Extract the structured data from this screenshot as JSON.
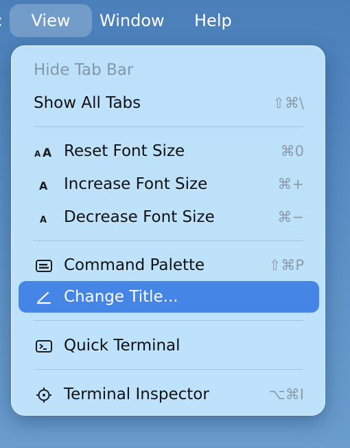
{
  "menubar": {
    "edge_label": ":",
    "items": [
      {
        "label": "View"
      },
      {
        "label": "Window"
      },
      {
        "label": "Help"
      }
    ]
  },
  "menu": {
    "items": [
      {
        "label": "Hide Tab Bar",
        "shortcut": "",
        "disabled": true,
        "icon": ""
      },
      {
        "label": "Show All Tabs",
        "shortcut": "⇧⌘\\",
        "disabled": false,
        "icon": ""
      },
      {
        "label": "Reset Font Size",
        "shortcut": "⌘0",
        "icon": "reset-font-size-icon",
        "icon_text": "AA"
      },
      {
        "label": "Increase Font Size",
        "shortcut": "⌘+",
        "icon": "increase-font-size-icon",
        "icon_text": "A"
      },
      {
        "label": "Decrease Font Size",
        "shortcut": "⌘−",
        "icon": "decrease-font-size-icon",
        "icon_text": "A"
      },
      {
        "label": "Command Palette",
        "shortcut": "⇧⌘P",
        "icon": "command-palette-icon"
      },
      {
        "label": "Change Title...",
        "shortcut": "",
        "icon": "pencil-icon",
        "highlighted": true
      },
      {
        "label": "Quick Terminal",
        "shortcut": "",
        "icon": "terminal-icon"
      },
      {
        "label": "Terminal Inspector",
        "shortcut": "⌥⌘I",
        "icon": "crosshair-icon"
      }
    ]
  },
  "colors": {
    "highlight": "#4585e6",
    "menu_background": "#c1e4fc",
    "desktop": "#5a8ec4",
    "disabled_text": "#8397a6",
    "shortcut_text": "#8a9aa8"
  }
}
